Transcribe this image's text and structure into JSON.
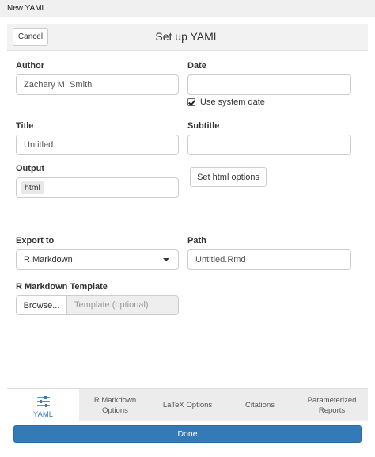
{
  "window": {
    "title": "New YAML"
  },
  "header": {
    "cancel_label": "Cancel",
    "title": "Set up YAML"
  },
  "form": {
    "author": {
      "label": "Author",
      "value": "Zachary M. Smith"
    },
    "date": {
      "label": "Date",
      "value": "",
      "use_system_date_label": "Use system date",
      "use_system_date_checked": true
    },
    "title": {
      "label": "Title",
      "value": "Untitled"
    },
    "subtitle": {
      "label": "Subtitle",
      "value": ""
    },
    "output": {
      "label": "Output",
      "value": "html",
      "options_button": "Set html options"
    },
    "export_to": {
      "label": "Export to",
      "selected": "R Markdown"
    },
    "path": {
      "label": "Path",
      "value": "Untitled.Rmd"
    },
    "template": {
      "label": "R Markdown Template",
      "browse_label": "Browse...",
      "placeholder": "Template (optional)"
    }
  },
  "tabs": [
    {
      "line1": "YAML",
      "line2": "",
      "active": true
    },
    {
      "line1": "R Markdown",
      "line2": "Options",
      "active": false
    },
    {
      "line1": "LaTeX Options",
      "line2": "",
      "active": false
    },
    {
      "line1": "Citations",
      "line2": "",
      "active": false
    },
    {
      "line1": "Parameterized",
      "line2": "Reports",
      "active": false
    }
  ],
  "footer": {
    "done_label": "Done"
  },
  "colors": {
    "accent": "#337ab7",
    "header_bg": "#f2f2f2",
    "tabbar_bg": "#ececec"
  },
  "icons": {
    "yaml_tab": "sliders-icon",
    "export_caret": "caret-down-icon",
    "checkbox": "checkbox-checked-icon"
  }
}
